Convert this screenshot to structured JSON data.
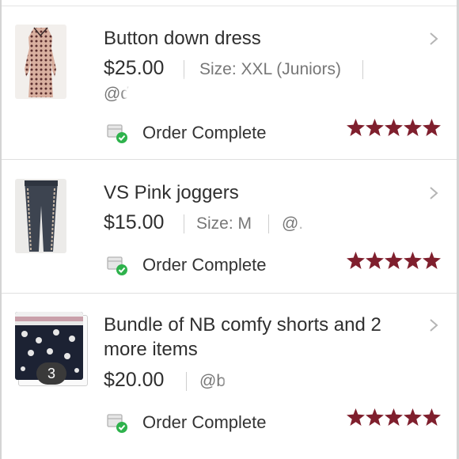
{
  "orders": [
    {
      "title": "Button down dress",
      "price": "$25.00",
      "size": "Size: XXL (Juniors)",
      "seller": "@d",
      "status": "Order Complete",
      "rating": 5
    },
    {
      "title": "VS Pink joggers",
      "price": "$15.00",
      "size": "Size: M",
      "seller": "@.",
      "status": "Order Complete",
      "rating": 5
    },
    {
      "title": "Bundle of NB comfy shorts and 2 more items",
      "price": "$20.00",
      "seller": "@b",
      "bundle_count": "3",
      "status": "Order Complete",
      "rating": 5
    }
  ],
  "colors": {
    "star": "#7f1f2d",
    "check_green": "#2eb24c",
    "text": "#2f2f2f"
  },
  "icons": [
    "chevron-right-icon",
    "package-check-icon",
    "star-icon"
  ]
}
